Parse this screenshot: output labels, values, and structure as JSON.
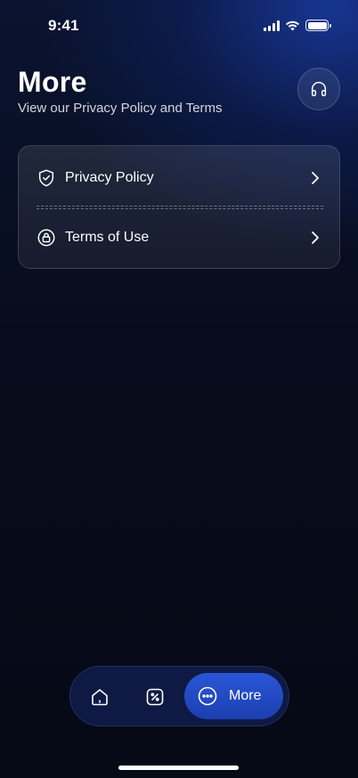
{
  "status_bar": {
    "time": "9:41",
    "icons": [
      "cellular-signal-icon",
      "wifi-icon",
      "battery-icon"
    ]
  },
  "header": {
    "title": "More",
    "subtitle": "View our Privacy Policy and Terms",
    "support_icon": "headphones-icon"
  },
  "menu": {
    "items": [
      {
        "label": "Privacy Policy",
        "icon": "shield-check-icon"
      },
      {
        "label": "Terms of Use",
        "icon": "lock-circle-icon"
      }
    ]
  },
  "tab_bar": {
    "tabs": [
      {
        "icon": "home-icon",
        "label": ""
      },
      {
        "icon": "percent-tag-icon",
        "label": ""
      },
      {
        "icon": "more-dots-icon",
        "label": "More"
      }
    ],
    "active_tab": "More"
  },
  "colors": {
    "background": "#070b18",
    "accent": "#2a56d6",
    "tab_bar": "#0e1a44"
  }
}
